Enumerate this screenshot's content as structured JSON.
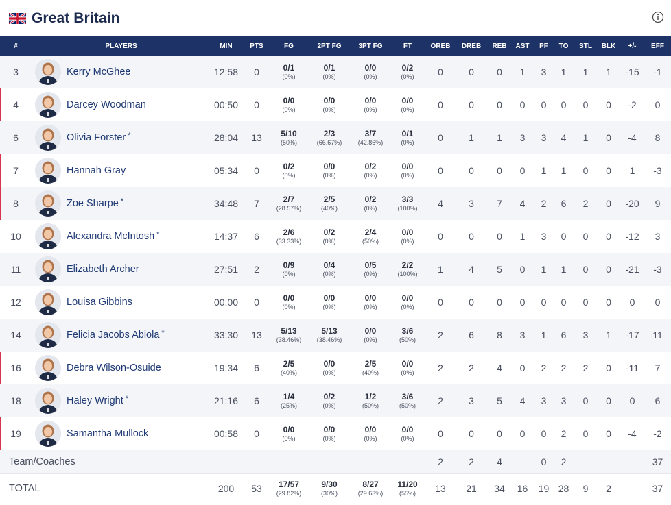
{
  "team": {
    "name": "Great Britain"
  },
  "columns": [
    "#",
    "PLAYERS",
    "MIN",
    "PTS",
    "FG",
    "2PT FG",
    "3PT FG",
    "FT",
    "OREB",
    "DREB",
    "REB",
    "AST",
    "PF",
    "TO",
    "STL",
    "BLK",
    "+/-",
    "EFF"
  ],
  "players": [
    {
      "num": "3",
      "name": "Kerry McGhee",
      "starter": false,
      "bench": false,
      "min": "12:58",
      "pts": "0",
      "fg": {
        "made": "0/1",
        "pct": "(0%)"
      },
      "fg2": {
        "made": "0/1",
        "pct": "(0%)"
      },
      "fg3": {
        "made": "0/0",
        "pct": "(0%)"
      },
      "ft": {
        "made": "0/2",
        "pct": "(0%)"
      },
      "oreb": "0",
      "dreb": "0",
      "reb": "0",
      "ast": "1",
      "pf": "3",
      "to": "1",
      "stl": "1",
      "blk": "1",
      "pm": "-15",
      "eff": "-1"
    },
    {
      "num": "4",
      "name": "Darcey Woodman",
      "starter": false,
      "bench": true,
      "min": "00:50",
      "pts": "0",
      "fg": {
        "made": "0/0",
        "pct": "(0%)"
      },
      "fg2": {
        "made": "0/0",
        "pct": "(0%)"
      },
      "fg3": {
        "made": "0/0",
        "pct": "(0%)"
      },
      "ft": {
        "made": "0/0",
        "pct": "(0%)"
      },
      "oreb": "0",
      "dreb": "0",
      "reb": "0",
      "ast": "0",
      "pf": "0",
      "to": "0",
      "stl": "0",
      "blk": "0",
      "pm": "-2",
      "eff": "0"
    },
    {
      "num": "6",
      "name": "Olivia Forster",
      "starter": true,
      "bench": false,
      "min": "28:04",
      "pts": "13",
      "fg": {
        "made": "5/10",
        "pct": "(50%)"
      },
      "fg2": {
        "made": "2/3",
        "pct": "(66.67%)"
      },
      "fg3": {
        "made": "3/7",
        "pct": "(42.86%)"
      },
      "ft": {
        "made": "0/1",
        "pct": "(0%)"
      },
      "oreb": "0",
      "dreb": "1",
      "reb": "1",
      "ast": "3",
      "pf": "3",
      "to": "4",
      "stl": "1",
      "blk": "0",
      "pm": "-4",
      "eff": "8"
    },
    {
      "num": "7",
      "name": "Hannah Gray",
      "starter": false,
      "bench": true,
      "min": "05:34",
      "pts": "0",
      "fg": {
        "made": "0/2",
        "pct": "(0%)"
      },
      "fg2": {
        "made": "0/0",
        "pct": "(0%)"
      },
      "fg3": {
        "made": "0/2",
        "pct": "(0%)"
      },
      "ft": {
        "made": "0/0",
        "pct": "(0%)"
      },
      "oreb": "0",
      "dreb": "0",
      "reb": "0",
      "ast": "0",
      "pf": "1",
      "to": "1",
      "stl": "0",
      "blk": "0",
      "pm": "1",
      "eff": "-3"
    },
    {
      "num": "8",
      "name": "Zoe Sharpe",
      "starter": true,
      "bench": true,
      "min": "34:48",
      "pts": "7",
      "fg": {
        "made": "2/7",
        "pct": "(28.57%)"
      },
      "fg2": {
        "made": "2/5",
        "pct": "(40%)"
      },
      "fg3": {
        "made": "0/2",
        "pct": "(0%)"
      },
      "ft": {
        "made": "3/3",
        "pct": "(100%)"
      },
      "oreb": "4",
      "dreb": "3",
      "reb": "7",
      "ast": "4",
      "pf": "2",
      "to": "6",
      "stl": "2",
      "blk": "0",
      "pm": "-20",
      "eff": "9"
    },
    {
      "num": "10",
      "name": "Alexandra McIntosh",
      "starter": true,
      "bench": false,
      "min": "14:37",
      "pts": "6",
      "fg": {
        "made": "2/6",
        "pct": "(33.33%)"
      },
      "fg2": {
        "made": "0/2",
        "pct": "(0%)"
      },
      "fg3": {
        "made": "2/4",
        "pct": "(50%)"
      },
      "ft": {
        "made": "0/0",
        "pct": "(0%)"
      },
      "oreb": "0",
      "dreb": "0",
      "reb": "0",
      "ast": "1",
      "pf": "3",
      "to": "0",
      "stl": "0",
      "blk": "0",
      "pm": "-12",
      "eff": "3"
    },
    {
      "num": "11",
      "name": "Elizabeth Archer",
      "starter": false,
      "bench": false,
      "min": "27:51",
      "pts": "2",
      "fg": {
        "made": "0/9",
        "pct": "(0%)"
      },
      "fg2": {
        "made": "0/4",
        "pct": "(0%)"
      },
      "fg3": {
        "made": "0/5",
        "pct": "(0%)"
      },
      "ft": {
        "made": "2/2",
        "pct": "(100%)"
      },
      "oreb": "1",
      "dreb": "4",
      "reb": "5",
      "ast": "0",
      "pf": "1",
      "to": "1",
      "stl": "0",
      "blk": "0",
      "pm": "-21",
      "eff": "-3"
    },
    {
      "num": "12",
      "name": "Louisa Gibbins",
      "starter": false,
      "bench": false,
      "min": "00:00",
      "pts": "0",
      "fg": {
        "made": "0/0",
        "pct": "(0%)"
      },
      "fg2": {
        "made": "0/0",
        "pct": "(0%)"
      },
      "fg3": {
        "made": "0/0",
        "pct": "(0%)"
      },
      "ft": {
        "made": "0/0",
        "pct": "(0%)"
      },
      "oreb": "0",
      "dreb": "0",
      "reb": "0",
      "ast": "0",
      "pf": "0",
      "to": "0",
      "stl": "0",
      "blk": "0",
      "pm": "0",
      "eff": "0"
    },
    {
      "num": "14",
      "name": "Felicia Jacobs Abiola",
      "starter": true,
      "bench": false,
      "min": "33:30",
      "pts": "13",
      "fg": {
        "made": "5/13",
        "pct": "(38.46%)"
      },
      "fg2": {
        "made": "5/13",
        "pct": "(38.46%)"
      },
      "fg3": {
        "made": "0/0",
        "pct": "(0%)"
      },
      "ft": {
        "made": "3/6",
        "pct": "(50%)"
      },
      "oreb": "2",
      "dreb": "6",
      "reb": "8",
      "ast": "3",
      "pf": "1",
      "to": "6",
      "stl": "3",
      "blk": "1",
      "pm": "-17",
      "eff": "11"
    },
    {
      "num": "16",
      "name": "Debra Wilson-Osuide",
      "starter": false,
      "bench": true,
      "min": "19:34",
      "pts": "6",
      "fg": {
        "made": "2/5",
        "pct": "(40%)"
      },
      "fg2": {
        "made": "0/0",
        "pct": "(0%)"
      },
      "fg3": {
        "made": "2/5",
        "pct": "(40%)"
      },
      "ft": {
        "made": "0/0",
        "pct": "(0%)"
      },
      "oreb": "2",
      "dreb": "2",
      "reb": "4",
      "ast": "0",
      "pf": "2",
      "to": "2",
      "stl": "2",
      "blk": "0",
      "pm": "-11",
      "eff": "7"
    },
    {
      "num": "18",
      "name": "Haley Wright",
      "starter": true,
      "bench": false,
      "min": "21:16",
      "pts": "6",
      "fg": {
        "made": "1/4",
        "pct": "(25%)"
      },
      "fg2": {
        "made": "0/2",
        "pct": "(0%)"
      },
      "fg3": {
        "made": "1/2",
        "pct": "(50%)"
      },
      "ft": {
        "made": "3/6",
        "pct": "(50%)"
      },
      "oreb": "2",
      "dreb": "3",
      "reb": "5",
      "ast": "4",
      "pf": "3",
      "to": "3",
      "stl": "0",
      "blk": "0",
      "pm": "0",
      "eff": "6"
    },
    {
      "num": "19",
      "name": "Samantha Mullock",
      "starter": false,
      "bench": true,
      "min": "00:58",
      "pts": "0",
      "fg": {
        "made": "0/0",
        "pct": "(0%)"
      },
      "fg2": {
        "made": "0/0",
        "pct": "(0%)"
      },
      "fg3": {
        "made": "0/0",
        "pct": "(0%)"
      },
      "ft": {
        "made": "0/0",
        "pct": "(0%)"
      },
      "oreb": "0",
      "dreb": "0",
      "reb": "0",
      "ast": "0",
      "pf": "0",
      "to": "2",
      "stl": "0",
      "blk": "0",
      "pm": "-4",
      "eff": "-2"
    }
  ],
  "team_coaches": {
    "label": "Team/Coaches",
    "oreb": "2",
    "dreb": "2",
    "reb": "4",
    "pf": "0",
    "to": "2",
    "eff": "37"
  },
  "totals": {
    "label": "TOTAL",
    "min": "200",
    "pts": "53",
    "fg": {
      "made": "17/57",
      "pct": "(29.82%)"
    },
    "fg2": {
      "made": "9/30",
      "pct": "(30%)"
    },
    "fg3": {
      "made": "8/27",
      "pct": "(29.63%)"
    },
    "ft": {
      "made": "11/20",
      "pct": "(55%)"
    },
    "oreb": "13",
    "dreb": "21",
    "reb": "34",
    "ast": "16",
    "pf": "19",
    "to": "28",
    "stl": "9",
    "blk": "2",
    "eff": "37"
  },
  "icons": {
    "flag": "uk-flag-icon",
    "info": "info-icon",
    "avatar": "player-headshot"
  },
  "colors": {
    "header_bg": "#1d3266",
    "bench_marker": "#d6344f",
    "row_alt": "#f4f5f8",
    "name_link": "#1f3a74"
  }
}
